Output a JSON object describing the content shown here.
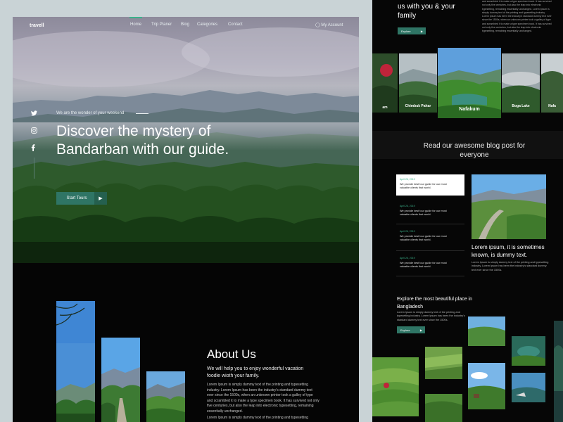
{
  "colors": {
    "accent": "#2f7565",
    "accent_line": "#3bb18a",
    "background": "#050505",
    "outer": "#c9d3d6"
  },
  "left": {
    "logo": "travell",
    "nav": [
      {
        "label": "Home",
        "active": true
      },
      {
        "label": "Trip Planer"
      },
      {
        "label": "Blog"
      },
      {
        "label": "Categories"
      },
      {
        "label": "Contact"
      }
    ],
    "account": {
      "label": "My Account",
      "icon": "user-icon"
    },
    "social": [
      "twitter-icon",
      "instagram-icon",
      "facebook-icon"
    ],
    "hero": {
      "tagline": "We are the wonder of your weekend",
      "title": "Discover the mystery of Bandarban with our guide.",
      "button": "Start Tours"
    },
    "about": {
      "title": "About Us",
      "subtitle": "We will help you to enjoy wonderful vacation foodie wioth your family.",
      "body1": "Lorem Ipsum is simply dummy text of the printing and typesetting industry. Lorem Ipsum has been the industry's standard dummy text ever since the 1500s, when an unknown printer took a galley of type and scrambled it to make a type specimen book. It has survived not only five centuries, but also the leap into electronic typesetting, remaining essentially unchanged.",
      "body2": "Lorem Ipsum is simply dummy text of the printing and typesetting"
    }
  },
  "right": {
    "top_text": "us with you & your family",
    "top_side_text": "and scrambled it to make a type specimen book. It has survived not only five centuries, but also the leap into electronic typesetting, remaining essentially unchanged. Lorem Ipsum is simply dummy text of the printing and typesetting industry. Lorem Ipsum has been the industry's standard dummy text ever since the 1500s, when an unknown printer took a galley of type and scrambled it to make a type specimen book. It has survived not only five centuries, but also the leap into electronic typesetting, remaining essentially unchanged.",
    "explore_button": "Explore",
    "gallery": [
      {
        "label": "am"
      },
      {
        "label": "Chimbuk Pahar"
      },
      {
        "label": "Nafakum"
      },
      {
        "label": "Boga Lake"
      },
      {
        "label": "Nafa"
      }
    ],
    "blog_title": "Read our awesome blog post for everyone",
    "posts": [
      {
        "date": "April 26, 2019",
        "text": "We provide best tour guide for our most valuable clients that world."
      },
      {
        "date": "April 26, 2019",
        "text": "We provide best tour guide for our most valuable clients that world."
      },
      {
        "date": "April 26, 2019",
        "text": "We provide best tour guide for our most valuable clients that world."
      },
      {
        "date": "April 26, 2019",
        "text": "We provide best tour guide for our most valuable clients that world."
      }
    ],
    "featured": {
      "title": "Lorem ipsum, it is sometimes known, is dummy text.",
      "body": "Lorem Ipsum is simply dummy text of the printing and typesetting industry. Lorem Ipsum has been the industry's standard dummy text ever since the 1500s."
    },
    "explore": {
      "title": "Explore the most beautiful place in Bangladesh",
      "body": "Lorem Ipsum is simply dummy text of the printing and typesetting industry. Lorem Ipsum has been the industry's standard dummy text ever since the 1500s."
    }
  }
}
